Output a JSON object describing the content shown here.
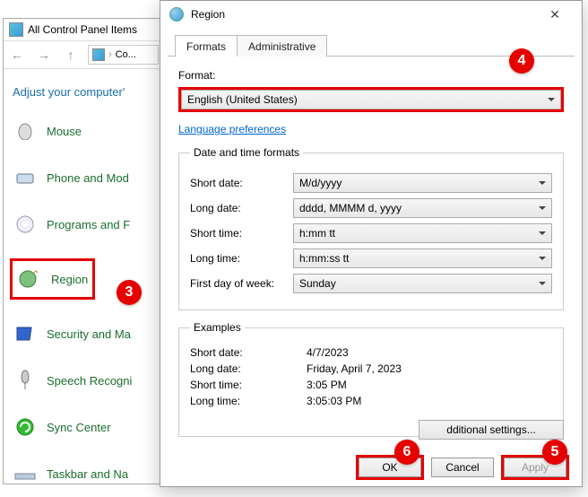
{
  "cp": {
    "title": "All Control Panel Items",
    "addr": "Co...",
    "heading": "Adjust your computer'",
    "items": [
      {
        "label": "Mouse"
      },
      {
        "label": "Phone and Mod"
      },
      {
        "label": "Programs and F"
      },
      {
        "label": "Region"
      },
      {
        "label": "Security and Ma"
      },
      {
        "label": "Speech Recogni"
      },
      {
        "label": "Sync Center"
      },
      {
        "label": "Taskbar and Na"
      }
    ]
  },
  "dlg": {
    "title": "Region",
    "tabs": [
      "Formats",
      "Administrative"
    ],
    "format_label": "Format:",
    "format_value": "English (United States)",
    "lang_pref": "Language preferences",
    "dt_legend": "Date and time formats",
    "rows": {
      "short_date_lbl": "Short date:",
      "short_date_val": "M/d/yyyy",
      "long_date_lbl": "Long date:",
      "long_date_val": "dddd, MMMM d, yyyy",
      "short_time_lbl": "Short time:",
      "short_time_val": "h:mm tt",
      "long_time_lbl": "Long time:",
      "long_time_val": "h:mm:ss tt",
      "first_day_lbl": "First day of week:",
      "first_day_val": "Sunday"
    },
    "ex_legend": "Examples",
    "ex": {
      "sd_lbl": "Short date:",
      "sd_val": "4/7/2023",
      "ld_lbl": "Long date:",
      "ld_val": "Friday, April 7, 2023",
      "st_lbl": "Short time:",
      "st_val": "3:05 PM",
      "lt_lbl": "Long time:",
      "lt_val": "3:05:03 PM"
    },
    "additional": "dditional settings...",
    "ok": "OK",
    "cancel": "Cancel",
    "apply": "Apply"
  },
  "callouts": {
    "c3": "3",
    "c4": "4",
    "c5": "5",
    "c6": "6"
  }
}
